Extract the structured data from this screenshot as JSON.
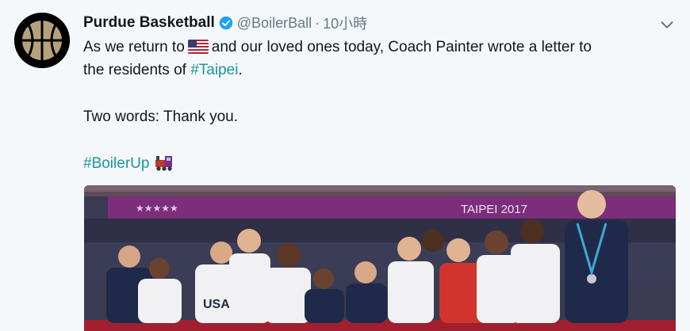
{
  "tweet": {
    "account": {
      "name": "Purdue Basketball",
      "handle": "@BoilerBall",
      "separator": "·",
      "time": "10小時",
      "avatar_icon": "purdue-basketball-logo"
    },
    "text": {
      "line1_a": "As we return to",
      "line1_b": "and our loved ones today, Coach Painter wrote a letter to",
      "line2_a": "the residents of",
      "line2_hashtag": "#Taipei",
      "line2_b": ".",
      "line3": "Two words: Thank you.",
      "line4_hashtag": "#BoilerUp",
      "emoji_flag": "us-flag-emoji",
      "emoji_train": "steam-locomotive-emoji"
    },
    "photo": {
      "banner_text": "TAIPEI 2017",
      "jersey_text": "USA"
    },
    "colors": {
      "hashtag": "#1b95a0",
      "verified": "#1da1f2",
      "banner": "#7c2e7a"
    }
  }
}
